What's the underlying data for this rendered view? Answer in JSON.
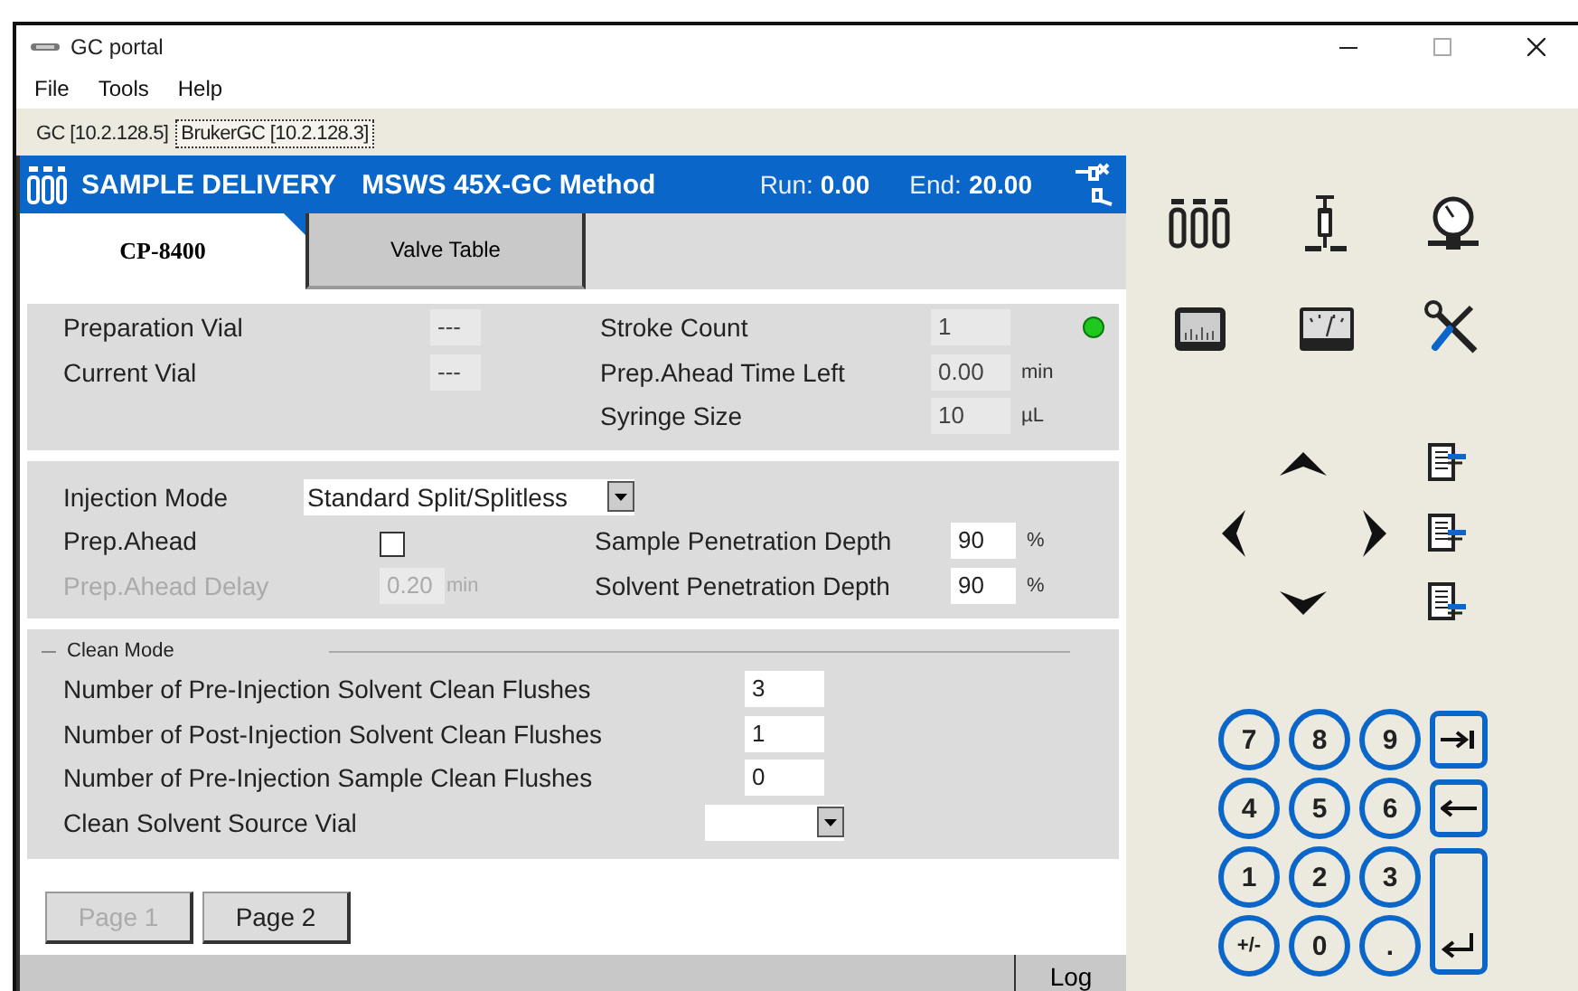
{
  "window": {
    "title": "GC portal"
  },
  "menu": [
    {
      "label": "File"
    },
    {
      "label": "Tools"
    },
    {
      "label": "Help"
    }
  ],
  "connection_tabs": [
    {
      "label": "GC [10.2.128.5]",
      "selected": false
    },
    {
      "label": "BrukerGC [10.2.128.3]",
      "selected": true
    }
  ],
  "header": {
    "title": "SAMPLE DELIVERY",
    "method": "MSWS 45X-GC Method",
    "run_label": "Run:",
    "run_value": "0.00",
    "end_label": "End:",
    "end_value": "20.00"
  },
  "tabs": [
    {
      "label": "CP-8400",
      "selected": true
    },
    {
      "label": "Valve Table",
      "selected": false
    }
  ],
  "status_section": {
    "left": [
      {
        "label": "Preparation Vial",
        "value": "---"
      },
      {
        "label": "Current Vial",
        "value": "---"
      }
    ],
    "right": [
      {
        "label": "Stroke Count",
        "value": "1"
      },
      {
        "label": "Prep.Ahead Time Left",
        "value": "0.00",
        "unit": "min"
      },
      {
        "label": "Syringe Size",
        "value": "10",
        "unit": "µL"
      }
    ],
    "indicator": {
      "color": "#1ec81e"
    }
  },
  "injection": {
    "mode_label": "Injection Mode",
    "mode_value": "Standard Split/Splitless",
    "prep_ahead": {
      "label": "Prep.Ahead",
      "checked": false
    },
    "prep_delay": {
      "label": "Prep.Ahead Delay",
      "value": "0.20",
      "unit": "min",
      "disabled": true
    },
    "penetration": [
      {
        "label": "Sample Penetration Depth",
        "value": "90",
        "unit": "%"
      },
      {
        "label": "Solvent Penetration Depth",
        "value": "90",
        "unit": "%"
      }
    ]
  },
  "clean_mode": {
    "title": "Clean Mode",
    "rows": [
      {
        "kind": "number",
        "label": "Number of Pre-Injection Solvent Clean Flushes",
        "value": "3"
      },
      {
        "kind": "number",
        "label": "Number of Post-Injection Solvent Clean Flushes",
        "value": "1"
      },
      {
        "kind": "number",
        "label": "Number of Pre-Injection Sample Clean Flushes",
        "value": "0"
      },
      {
        "kind": "dropdown",
        "label": "Clean Solvent Source Vial"
      }
    ]
  },
  "pages": [
    {
      "label": "Page 1",
      "disabled": true
    },
    {
      "label": "Page 2",
      "disabled": false
    }
  ],
  "status_bar": {
    "log": "Log"
  },
  "keypad": [
    {
      "kind": "digit",
      "label": "7"
    },
    {
      "kind": "digit",
      "label": "8"
    },
    {
      "kind": "digit",
      "label": "9"
    },
    {
      "kind": "tab"
    },
    {
      "kind": "digit",
      "label": "4"
    },
    {
      "kind": "digit",
      "label": "5"
    },
    {
      "kind": "digit",
      "label": "6"
    },
    {
      "kind": "backspace"
    },
    {
      "kind": "digit",
      "label": "1"
    },
    {
      "kind": "digit",
      "label": "2"
    },
    {
      "kind": "digit",
      "label": "3"
    },
    {
      "kind": "enter"
    },
    {
      "kind": "digit",
      "label": "+/-"
    },
    {
      "kind": "digit",
      "label": "0"
    },
    {
      "kind": "digit",
      "label": "."
    }
  ]
}
